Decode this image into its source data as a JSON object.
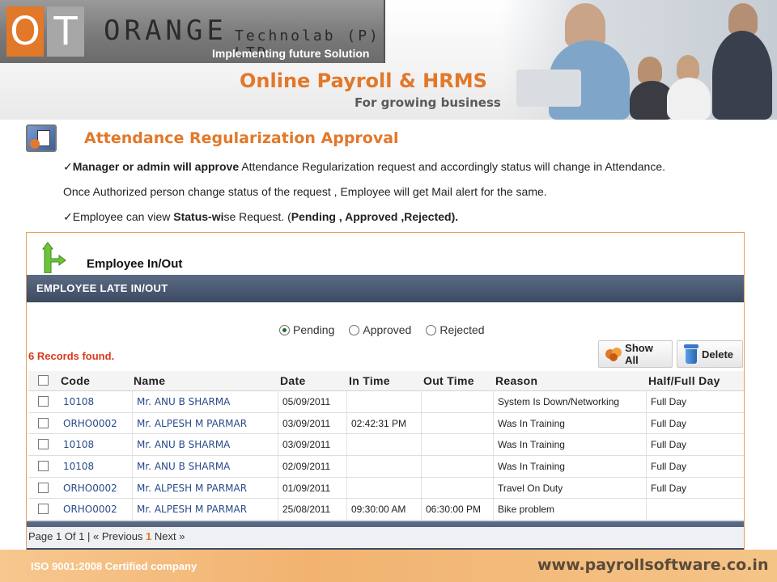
{
  "header": {
    "logo_o": "O",
    "logo_t": "T",
    "company": "ORANGE",
    "company_suffix": "Technolab (P) LTD",
    "tagline": "Implementing future Solution",
    "product_title": "Online Payroll & HRMS",
    "product_subtitle": "For growing business"
  },
  "section": {
    "title": "Attendance Regularization Approval",
    "bullet1_bold": "Manager or admin will approve",
    "bullet1_rest": " Attendance Regularization request and accordingly status will change in Attendance.",
    "line2": "Once Authorized person change status of the request , Employee will get Mail alert for the same.",
    "bullet3_a": "Employee can view ",
    "bullet3_bold": "Status-wi",
    "bullet3_b": "se Request. (",
    "bullet3_bold2": "Pending , Approved ,Rejected).",
    "check_glyph": "✓"
  },
  "panel": {
    "title": "Employee In/Out",
    "bar_title": "EMPLOYEE LATE IN/OUT",
    "filters": [
      {
        "label": "Pending",
        "selected": true
      },
      {
        "label": "Approved",
        "selected": false
      },
      {
        "label": "Rejected",
        "selected": false
      }
    ],
    "records_text": "6 Records found.",
    "show_all_label": "Show All",
    "delete_label": "Delete",
    "columns": [
      "Code",
      "Name",
      "Date",
      "In Time",
      "Out Time",
      "Reason",
      "Half/Full Day"
    ],
    "rows": [
      {
        "code": "10108",
        "name": "Mr. ANU B SHARMA",
        "date": "05/09/2011",
        "in_time": "",
        "out_time": "",
        "reason": "System Is Down/Networking",
        "day": "Full Day"
      },
      {
        "code": "ORHO0002",
        "name": "Mr. ALPESH M PARMAR",
        "date": "03/09/2011",
        "in_time": "02:42:31 PM",
        "out_time": "",
        "reason": "Was In Training",
        "day": "Full Day"
      },
      {
        "code": "10108",
        "name": "Mr. ANU B SHARMA",
        "date": "03/09/2011",
        "in_time": "",
        "out_time": "",
        "reason": "Was In Training",
        "day": "Full Day"
      },
      {
        "code": "10108",
        "name": "Mr. ANU B SHARMA",
        "date": "02/09/2011",
        "in_time": "",
        "out_time": "",
        "reason": "Was In Training",
        "day": "Full Day"
      },
      {
        "code": "ORHO0002",
        "name": "Mr. ALPESH M PARMAR",
        "date": "01/09/2011",
        "in_time": "",
        "out_time": "",
        "reason": "Travel On Duty",
        "day": "Full Day"
      },
      {
        "code": "ORHO0002",
        "name": "Mr. ALPESH M PARMAR",
        "date": "25/08/2011",
        "in_time": "09:30:00 AM",
        "out_time": "06:30:00 PM",
        "reason": "Bike problem",
        "day": ""
      }
    ],
    "pager": {
      "page_text": "Page 1 Of 1 |",
      "previous": "« Previous",
      "current": "1",
      "next": "Next »"
    }
  },
  "footer": {
    "iso": "ISO 9001:2008 Certified company",
    "site": "www.payrollsoftware.co.in"
  },
  "colors": {
    "accent": "#e2782a",
    "bar": "#3c4a62",
    "records": "#d83a1c"
  }
}
